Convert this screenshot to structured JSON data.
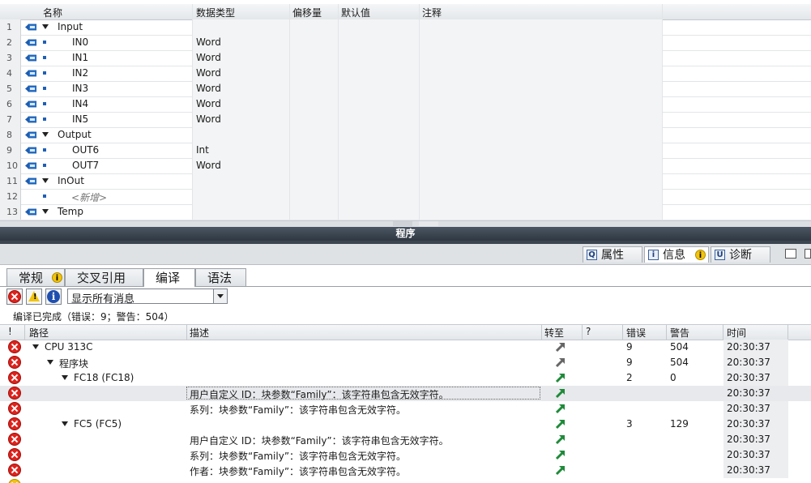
{
  "interface": {
    "headers": {
      "name": "名称",
      "datatype": "数据类型",
      "offset": "偏移量",
      "default": "默认值",
      "comment": "注释"
    },
    "rows": [
      {
        "num": "1",
        "kind": "section",
        "name": "Input",
        "type": ""
      },
      {
        "num": "2",
        "kind": "item",
        "name": "IN0",
        "type": "Word"
      },
      {
        "num": "3",
        "kind": "item",
        "name": "IN1",
        "type": "Word"
      },
      {
        "num": "4",
        "kind": "item",
        "name": "IN2",
        "type": "Word"
      },
      {
        "num": "5",
        "kind": "item",
        "name": "IN3",
        "type": "Word"
      },
      {
        "num": "6",
        "kind": "item",
        "name": "IN4",
        "type": "Word"
      },
      {
        "num": "7",
        "kind": "item",
        "name": "IN5",
        "type": "Word"
      },
      {
        "num": "8",
        "kind": "section",
        "name": "Output",
        "type": ""
      },
      {
        "num": "9",
        "kind": "item",
        "name": "OUT6",
        "type": "Int"
      },
      {
        "num": "10",
        "kind": "item",
        "name": "OUT7",
        "type": "Word"
      },
      {
        "num": "11",
        "kind": "section",
        "name": "InOut",
        "type": ""
      },
      {
        "num": "12",
        "kind": "add",
        "name": "<新增>",
        "type": ""
      },
      {
        "num": "13",
        "kind": "section",
        "name": "Temp",
        "type": ""
      }
    ]
  },
  "program_bar": "程序",
  "inspector_tabs": {
    "properties": "属性",
    "info": "信息",
    "diagnostics": "诊断"
  },
  "sub_tabs": {
    "general": "常规",
    "cross_ref": "交叉引用",
    "compile": "编译",
    "syntax": "语法"
  },
  "filter": {
    "selected": "显示所有消息"
  },
  "summary": "编译已完成（错误：9；警告：504）",
  "messages": {
    "headers": {
      "bang": "!",
      "path": "路径",
      "desc": "描述",
      "goto": "转至",
      "q": "?",
      "errors": "错误",
      "warnings": "警告",
      "time": "时间"
    },
    "rows": [
      {
        "level": 0,
        "path": "CPU 313C",
        "desc": "",
        "errors": "9",
        "warnings": "504",
        "time": "20:30:37",
        "goto": "grey",
        "tri": true
      },
      {
        "level": 1,
        "path": "程序块",
        "desc": "",
        "errors": "9",
        "warnings": "504",
        "time": "20:30:37",
        "goto": "grey",
        "tri": true
      },
      {
        "level": 2,
        "path": "FC18 (FC18)",
        "desc": "",
        "errors": "2",
        "warnings": "0",
        "time": "20:30:37",
        "goto": "green",
        "tri": true
      },
      {
        "level": 3,
        "path": "",
        "desc": "用户自定义 ID：块参数“Family”：该字符串包含无效字符。",
        "errors": "",
        "warnings": "",
        "time": "20:30:37",
        "goto": "green",
        "tri": false,
        "selected": true
      },
      {
        "level": 3,
        "path": "",
        "desc": "系列：块参数“Family”：该字符串包含无效字符。",
        "errors": "",
        "warnings": "",
        "time": "20:30:37",
        "goto": "green",
        "tri": false
      },
      {
        "level": 2,
        "path": "FC5 (FC5)",
        "desc": "",
        "errors": "3",
        "warnings": "129",
        "time": "20:30:37",
        "goto": "green",
        "tri": true
      },
      {
        "level": 3,
        "path": "",
        "desc": "用户自定义 ID：块参数“Family”：该字符串包含无效字符。",
        "errors": "",
        "warnings": "",
        "time": "20:30:37",
        "goto": "green",
        "tri": false
      },
      {
        "level": 3,
        "path": "",
        "desc": "系列：块参数“Family”：该字符串包含无效字符。",
        "errors": "",
        "warnings": "",
        "time": "20:30:37",
        "goto": "green",
        "tri": false
      },
      {
        "level": 3,
        "path": "",
        "desc": "作者：块参数“Family”：该字符串包含无效字符。",
        "errors": "",
        "warnings": "",
        "time": "20:30:37",
        "goto": "green",
        "tri": false
      }
    ]
  },
  "colors": {
    "accent": "#1f5fb5",
    "error": "#e0221c",
    "goto_green": "#1f8a3a",
    "goto_grey": "#666666"
  }
}
